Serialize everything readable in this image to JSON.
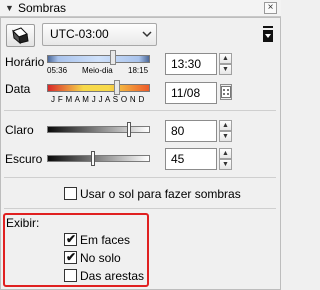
{
  "window": {
    "title": "Sombras",
    "collapse_icon": "triangle-down-icon",
    "close_icon": "close-icon"
  },
  "toolbar": {
    "tool_icon": "shadow-tool-icon",
    "timezone": "UTC-03:00",
    "side_icon": "panel-options-icon"
  },
  "time": {
    "label": "Horário",
    "sunrise": "05:36",
    "noon": "Meio-dia",
    "sunset": "18:15",
    "value": "13:30",
    "slider_fraction": 0.64
  },
  "date": {
    "label": "Data",
    "months": "J F M A M J J A S O N D",
    "value": "11/08",
    "slider_fraction": 0.68
  },
  "light": {
    "label": "Claro",
    "value": "80",
    "slider_fraction": 0.8
  },
  "dark": {
    "label": "Escuro",
    "value": "45",
    "slider_fraction": 0.45
  },
  "use_sun": {
    "label": "Usar o sol para fazer sombras",
    "checked": false
  },
  "display": {
    "label": "Exibir:",
    "options": [
      {
        "label": "Em faces",
        "checked": true
      },
      {
        "label": "No solo",
        "checked": true
      },
      {
        "label": "Das arestas",
        "checked": false
      }
    ]
  }
}
